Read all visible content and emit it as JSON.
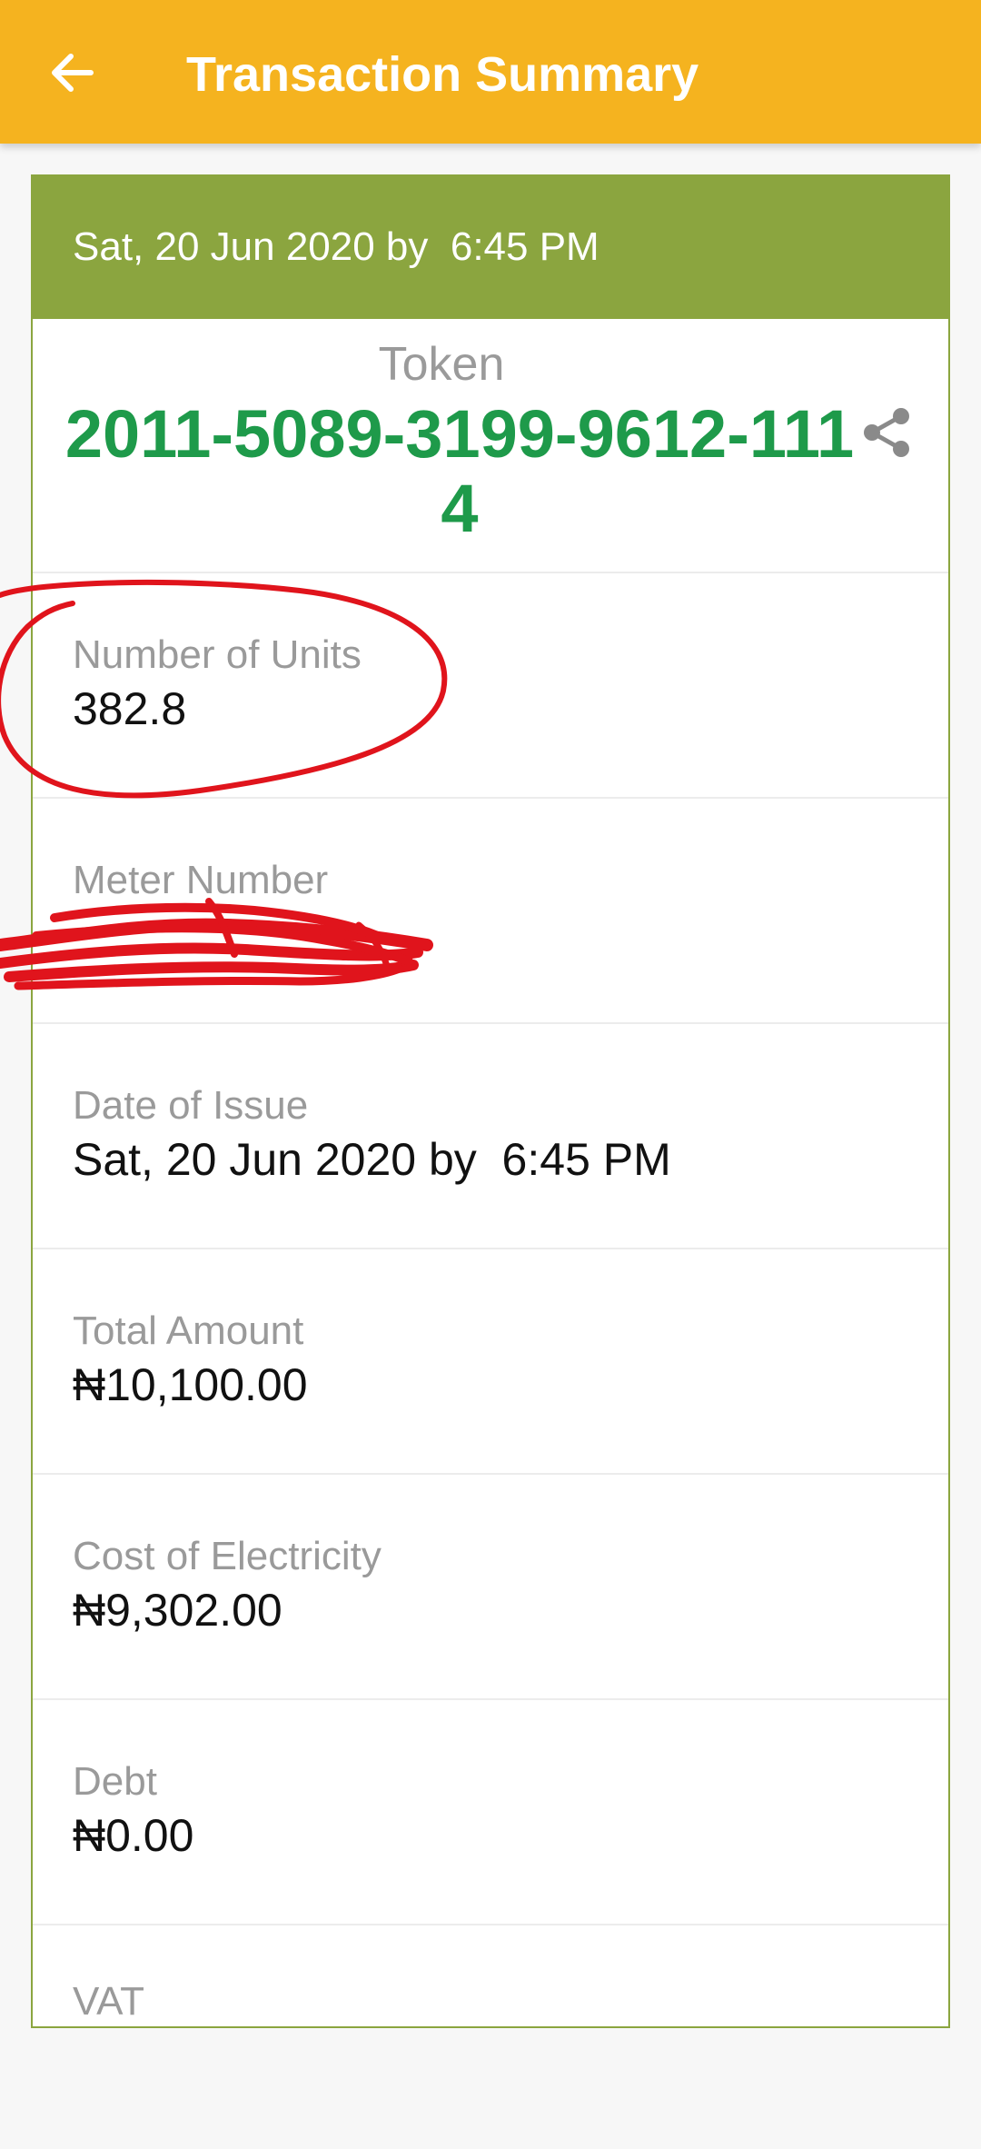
{
  "app_bar": {
    "title": "Transaction Summary",
    "back_icon": "arrow-left-icon",
    "color": "#f5b31f"
  },
  "card": {
    "header_text": "Sat, 20 Jun 2020 by  6:45 PM",
    "header_color": "#8ba53f",
    "token": {
      "label": "Token",
      "value": "2011-5089-3199-9612-1114",
      "value_color": "#1e9a4a",
      "share_icon": "share-icon"
    },
    "rows": [
      {
        "label": "Number of Units",
        "value": "382.8"
      },
      {
        "label": "Meter Number",
        "value": ""
      },
      {
        "label": "Date of Issue",
        "value": "Sat, 20 Jun 2020 by  6:45 PM"
      },
      {
        "label": "Total Amount",
        "value": "₦10,100.00"
      },
      {
        "label": "Cost of Electricity",
        "value": "₦9,302.00"
      },
      {
        "label": "Debt",
        "value": "₦0.00"
      },
      {
        "label": "VAT",
        "value": ""
      }
    ]
  },
  "annotations": {
    "color": "#e0141c",
    "units_circle": "red-ellipse-annotation",
    "meter_scribble": "red-scribble-redaction"
  }
}
